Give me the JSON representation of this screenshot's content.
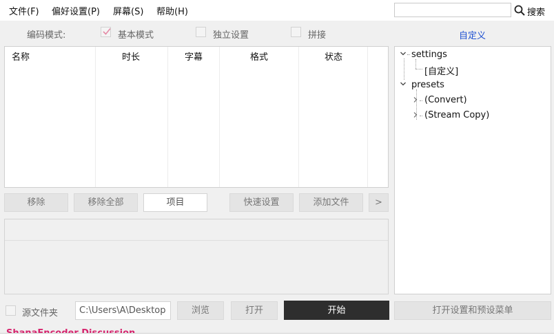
{
  "menu": {
    "file": "文件(F)",
    "preferences": "偏好设置(P)",
    "subtitles": "屏幕(S)",
    "help": "帮助(H)"
  },
  "search": {
    "value": "",
    "placeholder": "",
    "label": "搜索"
  },
  "mode": {
    "label": "编码模式:",
    "basic": {
      "label": "基本模式",
      "checked": true
    },
    "independent": {
      "label": "独立设置",
      "checked": false
    },
    "concat": {
      "label": "拼接",
      "checked": false
    },
    "custom_link": "自定义"
  },
  "file_list": {
    "columns": [
      "名称",
      "时长",
      "字幕",
      "格式",
      "状态"
    ],
    "rows": []
  },
  "tree": {
    "settings_label": "settings",
    "settings_child": "[自定义]",
    "presets_label": "presets",
    "preset_children": [
      "(Convert)",
      "(Stream Copy)"
    ]
  },
  "actions": {
    "remove": "移除",
    "remove_all": "移除全部",
    "item": "项目",
    "quick_settings": "快速设置",
    "add_file": "添加文件",
    "more": ">"
  },
  "bottom": {
    "source_folder_label": "源文件夹",
    "source_folder_checked": false,
    "path": "C:\\Users\\A\\Desktop",
    "browse": "浏览",
    "open": "打开",
    "start": "开始",
    "open_settings_menu": "打开设置和预设菜单"
  },
  "footer": {
    "discussion": "ShanaEncoder Discussion"
  },
  "colors": {
    "accent_link": "#1d4fd1",
    "start_bg": "#2e2e2e",
    "discussion": "#d6246e",
    "check": "#e58aa6"
  }
}
